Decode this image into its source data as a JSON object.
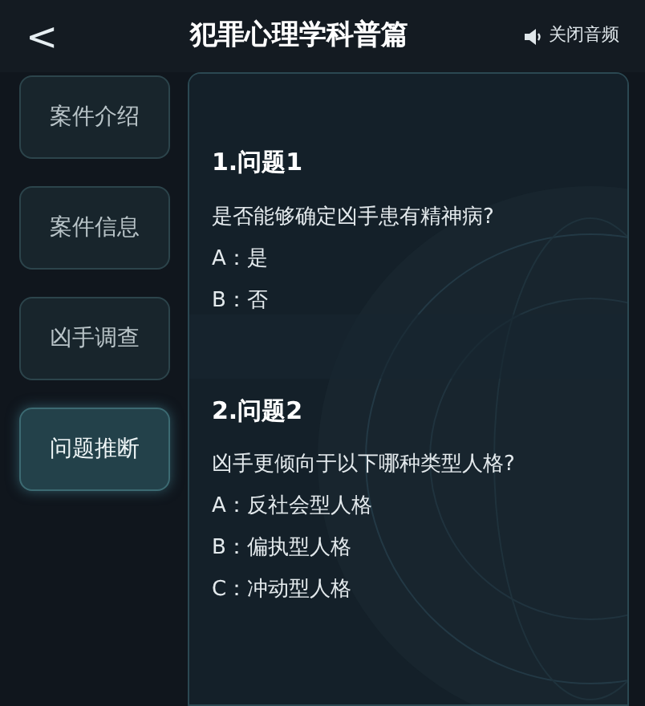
{
  "header": {
    "back": "<",
    "title": "犯罪心理学科普篇",
    "audio": "关闭音频"
  },
  "sidebar": {
    "items": [
      {
        "label": "案件介绍",
        "selected": false
      },
      {
        "label": "案件信息",
        "selected": false
      },
      {
        "label": "凶手调查",
        "selected": false
      },
      {
        "label": "问题推断",
        "selected": true
      }
    ]
  },
  "questions": [
    {
      "title": "1.问题1",
      "text": "是否能够确定凶手患有精神病?",
      "options": [
        "A：是",
        "B：否"
      ]
    },
    {
      "title": "2.问题2",
      "text": "凶手更倾向于以下哪种类型人格?",
      "options": [
        "A：反社会型人格",
        "B：偏执型人格",
        "C：冲动型人格"
      ]
    }
  ]
}
